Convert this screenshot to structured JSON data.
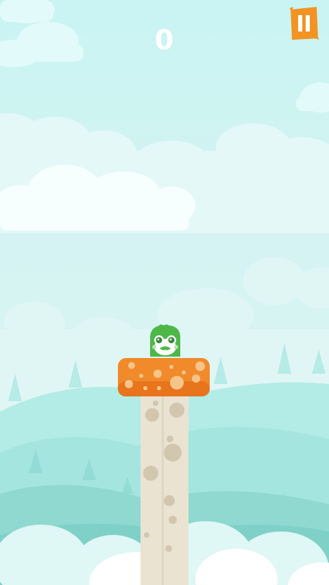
{
  "hud": {
    "score": "0",
    "pause_icon": "pause-icon"
  },
  "colors": {
    "sky_top": "#c9f4f3",
    "platform_orange": "#f08a2a",
    "pillar": "#e7dfcb",
    "character_green": "#4db848",
    "hill_teal": "#9fe4dc"
  },
  "scene": {
    "character": "green-blob-character",
    "platform": "orange-spotted-platform",
    "pillar": "stone-pillar"
  }
}
